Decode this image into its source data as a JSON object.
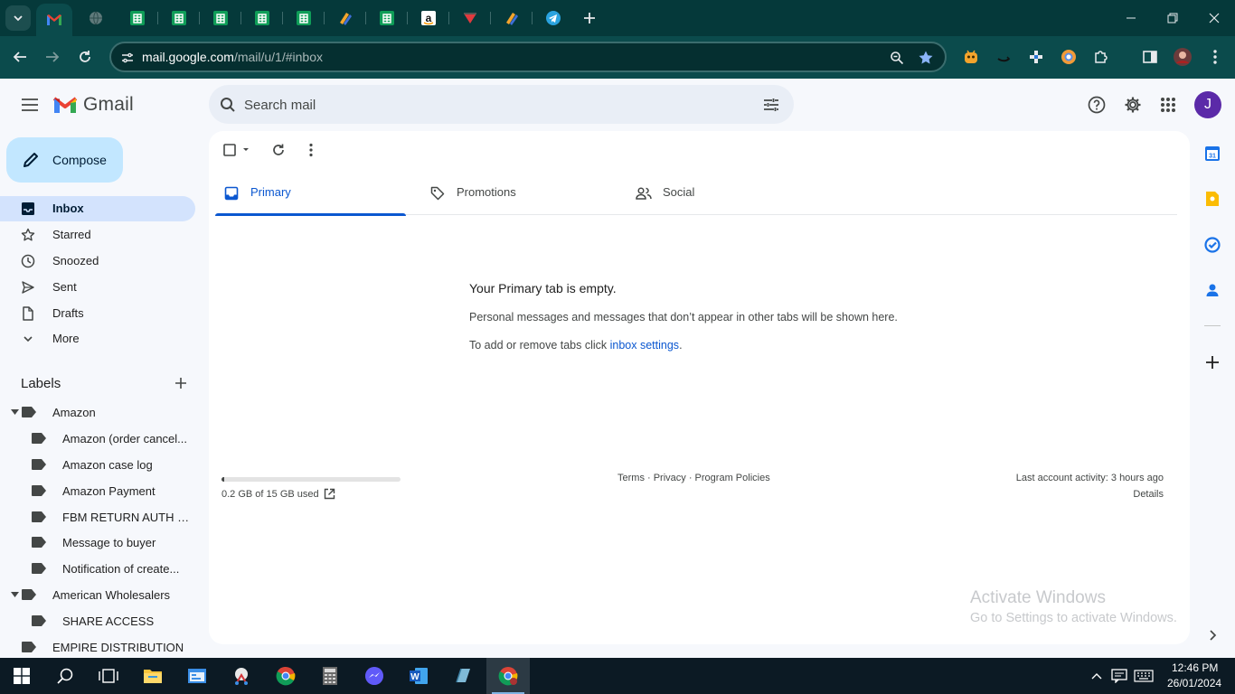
{
  "browser": {
    "address": {
      "host": "mail.google.com",
      "path": "/mail/u/1/#inbox"
    },
    "tabs": [
      {
        "icon": "gmail-icon",
        "active": true
      },
      {
        "icon": "globe-icon"
      },
      {
        "icon": "google-sheets-icon"
      },
      {
        "icon": "google-sheets-icon"
      },
      {
        "icon": "google-sheets-icon"
      },
      {
        "icon": "google-sheets-icon"
      },
      {
        "icon": "google-sheets-icon"
      },
      {
        "icon": "sellerboard-icon"
      },
      {
        "icon": "google-sheets-icon"
      },
      {
        "icon": "amazon-icon"
      },
      {
        "icon": "red-triangle-icon"
      },
      {
        "icon": "sellerboard-icon"
      },
      {
        "icon": "telegram-icon"
      }
    ]
  },
  "gmail": {
    "logo_text": "Gmail",
    "search_placeholder": "Search mail",
    "avatar_letter": "J",
    "compose_label": "Compose",
    "nav": [
      {
        "label": "Inbox",
        "icon": "inbox-icon",
        "active": true
      },
      {
        "label": "Starred",
        "icon": "star-icon"
      },
      {
        "label": "Snoozed",
        "icon": "clock-icon"
      },
      {
        "label": "Sent",
        "icon": "send-icon"
      },
      {
        "label": "Drafts",
        "icon": "draft-icon"
      },
      {
        "label": "More",
        "icon": "chevron-down-icon"
      }
    ],
    "labels_title": "Labels",
    "labels": [
      {
        "label": "Amazon",
        "level": 0,
        "expanded": true
      },
      {
        "label": "Amazon (order cancel...",
        "level": 1
      },
      {
        "label": "Amazon case log",
        "level": 1
      },
      {
        "label": "Amazon Payment",
        "level": 1
      },
      {
        "label": "FBM RETURN AUTH B...",
        "level": 1
      },
      {
        "label": "Message to buyer",
        "level": 1
      },
      {
        "label": "Notification of create...",
        "level": 1
      },
      {
        "label": "American Wholesalers",
        "level": 0,
        "expanded": true
      },
      {
        "label": "SHARE ACCESS",
        "level": 1
      },
      {
        "label": "EMPIRE DISTRIBUTION",
        "level": 0
      }
    ],
    "tabs": [
      {
        "label": "Primary",
        "icon": "inbox-tab-icon",
        "active": true
      },
      {
        "label": "Promotions",
        "icon": "tag-icon"
      },
      {
        "label": "Social",
        "icon": "people-icon"
      }
    ],
    "empty_title": "Your Primary tab is empty.",
    "empty_desc": "Personal messages and messages that don’t appear in other tabs will be shown here.",
    "empty_hint_prefix": "To add or remove tabs click ",
    "empty_hint_link": "inbox settings",
    "empty_hint_suffix": ".",
    "storage_text": "0.2 GB of 15 GB used",
    "storage_fraction": 0.013,
    "footer_links": "Terms · Privacy · Program Policies",
    "last_activity": "Last account activity: 3 hours ago",
    "details": "Details"
  },
  "watermark": {
    "title": "Activate Windows",
    "subtitle": "Go to Settings to activate Windows."
  },
  "taskbar": {
    "time": "12:46 PM",
    "date": "26/01/2024"
  },
  "colors": {
    "chrome_frame": "#05393a",
    "chrome_toolbar": "#0b4b4c",
    "gmail_bg": "#f6f8fc",
    "active_nav": "#d3e3fd",
    "compose_bg": "#c2e7ff",
    "primary_blue": "#0b57d0",
    "taskbar": "#0c1a24"
  }
}
